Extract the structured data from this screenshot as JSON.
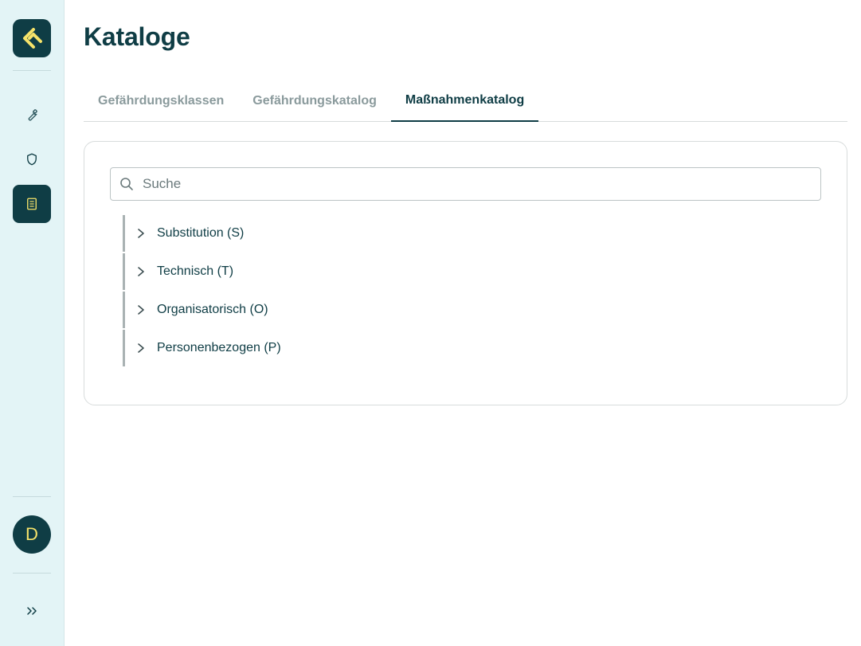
{
  "page": {
    "title": "Kataloge"
  },
  "tabs": [
    {
      "label": "Gefährdungsklassen",
      "active": false
    },
    {
      "label": "Gefährdungskatalog",
      "active": false
    },
    {
      "label": "Maßnahmenkatalog",
      "active": true
    }
  ],
  "search": {
    "placeholder": "Suche",
    "value": ""
  },
  "tree": [
    {
      "label": "Substitution (S)"
    },
    {
      "label": "Technisch (T)"
    },
    {
      "label": "Organisatorisch (O)"
    },
    {
      "label": "Personenbezogen (P)"
    }
  ],
  "user": {
    "initial": "D"
  },
  "sidebar": {
    "items": [
      {
        "icon": "wrench-icon",
        "active": false
      },
      {
        "icon": "shield-icon",
        "active": false
      },
      {
        "icon": "catalog-icon",
        "active": true
      }
    ]
  },
  "colors": {
    "brand": "#0f3d45",
    "accent": "#f6e36a",
    "sidebar_bg": "#e3f4f6"
  }
}
